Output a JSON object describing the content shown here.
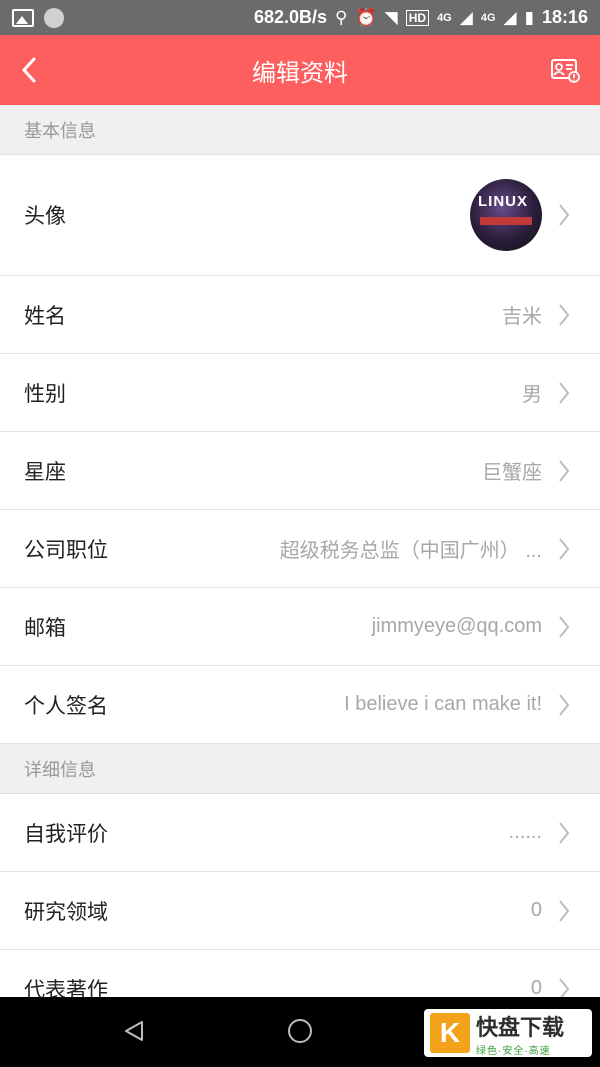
{
  "status_bar": {
    "network_speed": "682.0B/s",
    "signal_1": "4G",
    "signal_2": "4G",
    "time": "18:16",
    "hd_label": "HD"
  },
  "header": {
    "title": "编辑资料",
    "bg_color": "#fd5f5f"
  },
  "sections": {
    "basic": {
      "title": "基本信息",
      "avatar_label": "头像",
      "avatar_image_text": "LINUX",
      "rows": [
        {
          "label": "姓名",
          "value": "吉米"
        },
        {
          "label": "性别",
          "value": "男"
        },
        {
          "label": "星座",
          "value": "巨蟹座"
        },
        {
          "label": "公司职位",
          "value": "超级税务总监（中国广州） ..."
        },
        {
          "label": "邮箱",
          "value": "jimmyeye@qq.com"
        },
        {
          "label": "个人签名",
          "value": "I believe i can make it!"
        }
      ]
    },
    "detail": {
      "title": "详细信息",
      "rows": [
        {
          "label": "自我评价",
          "value": "......"
        },
        {
          "label": "研究领域",
          "value": "0"
        },
        {
          "label": "代表著作",
          "value": "0"
        }
      ]
    }
  },
  "watermark": {
    "logo": "K",
    "brand": "快盘下载",
    "tagline": "绿色·安全·高速"
  }
}
